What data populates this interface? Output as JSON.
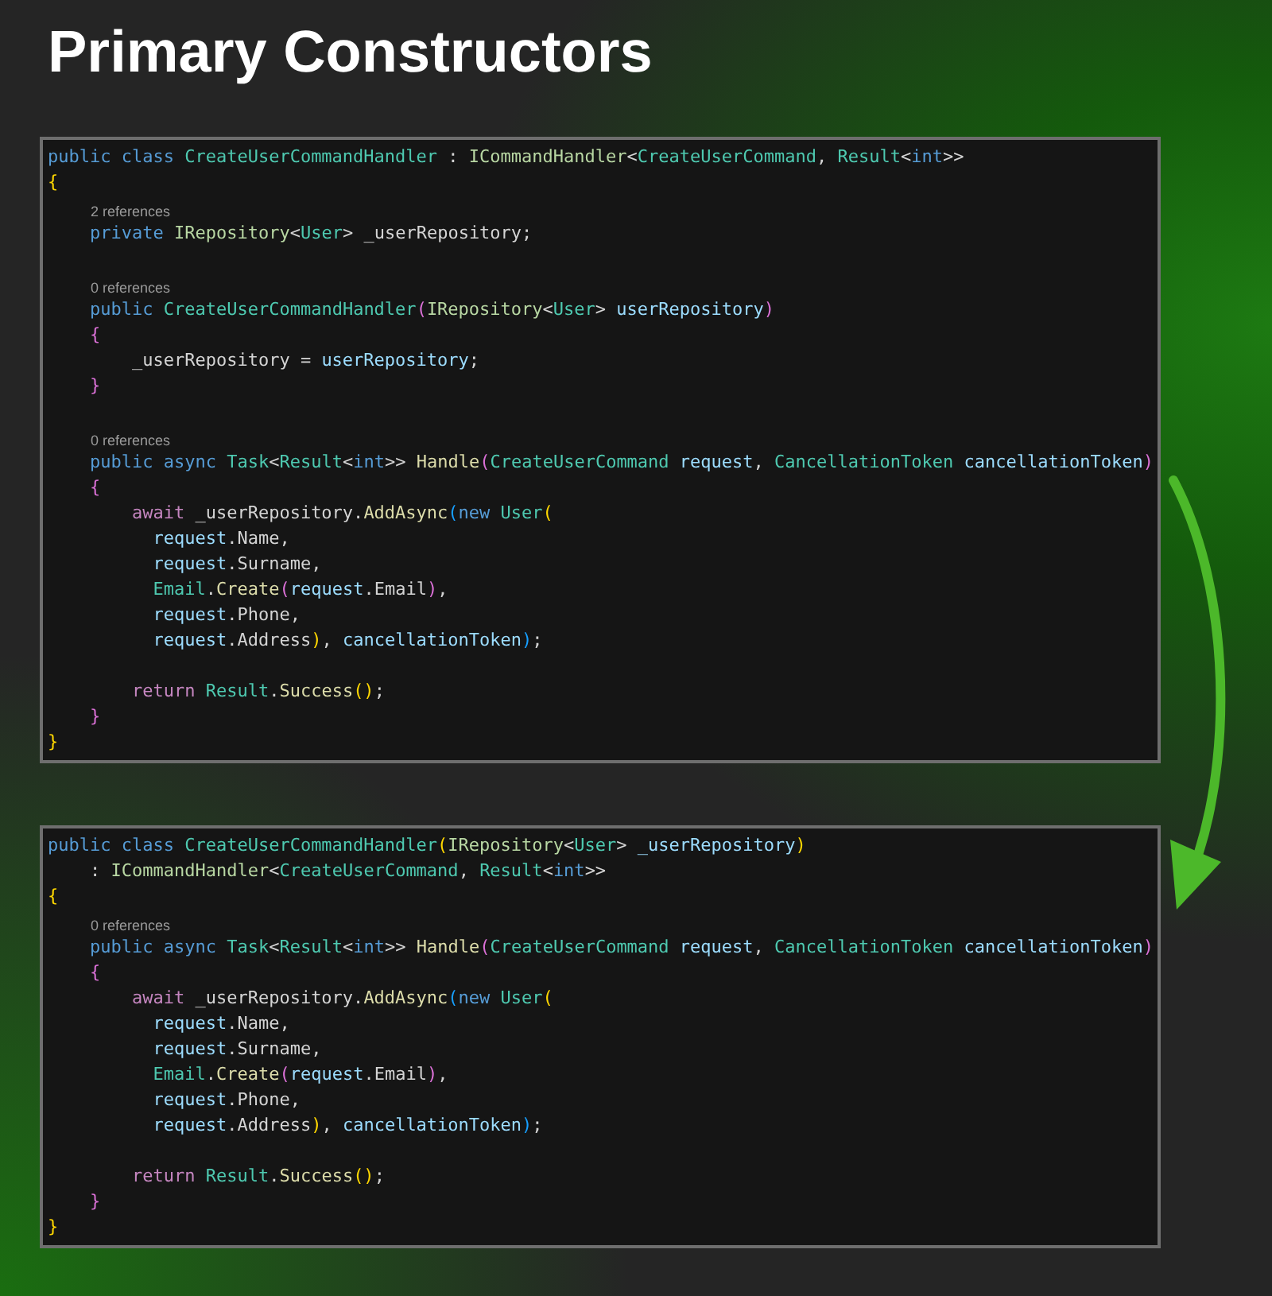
{
  "title": "Primary Constructors",
  "panels": [
    {
      "lines": [
        {
          "kind": "code",
          "tokens": [
            {
              "text": "public class ",
              "kind": "kw"
            },
            {
              "text": "CreateUserCommandHandler",
              "kind": "type"
            },
            {
              "text": " : ",
              "kind": "txt"
            },
            {
              "text": "ICommandHandler",
              "kind": "iface"
            },
            {
              "text": "<",
              "kind": "txt"
            },
            {
              "text": "CreateUserCommand",
              "kind": "type"
            },
            {
              "text": ", ",
              "kind": "txt"
            },
            {
              "text": "Result",
              "kind": "type"
            },
            {
              "text": "<",
              "kind": "txt"
            },
            {
              "text": "int",
              "kind": "kw"
            },
            {
              "text": ">>",
              "kind": "txt"
            }
          ]
        },
        {
          "kind": "code",
          "tokens": [
            {
              "text": "{",
              "kind": "b1"
            }
          ]
        },
        {
          "kind": "lens",
          "text": "2 references"
        },
        {
          "kind": "code",
          "tokens": [
            {
              "text": "    private ",
              "kind": "kw"
            },
            {
              "text": "IRepository",
              "kind": "iface"
            },
            {
              "text": "<",
              "kind": "txt"
            },
            {
              "text": "User",
              "kind": "type"
            },
            {
              "text": "> _userRepository;",
              "kind": "txt"
            }
          ]
        },
        {
          "kind": "blank"
        },
        {
          "kind": "lens",
          "text": "0 references"
        },
        {
          "kind": "code",
          "tokens": [
            {
              "text": "    public ",
              "kind": "kw"
            },
            {
              "text": "CreateUserCommandHandler",
              "kind": "type"
            },
            {
              "text": "(",
              "kind": "b2"
            },
            {
              "text": "IRepository",
              "kind": "iface"
            },
            {
              "text": "<",
              "kind": "txt"
            },
            {
              "text": "User",
              "kind": "type"
            },
            {
              "text": "> ",
              "kind": "txt"
            },
            {
              "text": "userRepository",
              "kind": "var"
            },
            {
              "text": ")",
              "kind": "b2"
            }
          ]
        },
        {
          "kind": "code",
          "tokens": [
            {
              "text": "    {",
              "kind": "b2"
            }
          ]
        },
        {
          "kind": "code",
          "tokens": [
            {
              "text": "        _userRepository = ",
              "kind": "txt"
            },
            {
              "text": "userRepository",
              "kind": "var"
            },
            {
              "text": ";",
              "kind": "txt"
            }
          ]
        },
        {
          "kind": "code",
          "tokens": [
            {
              "text": "    }",
              "kind": "b2"
            }
          ]
        },
        {
          "kind": "blank"
        },
        {
          "kind": "lens",
          "text": "0 references"
        },
        {
          "kind": "code",
          "tokens": [
            {
              "text": "    public async ",
              "kind": "kw"
            },
            {
              "text": "Task",
              "kind": "type"
            },
            {
              "text": "<",
              "kind": "txt"
            },
            {
              "text": "Result",
              "kind": "type"
            },
            {
              "text": "<",
              "kind": "txt"
            },
            {
              "text": "int",
              "kind": "kw"
            },
            {
              "text": ">> ",
              "kind": "txt"
            },
            {
              "text": "Handle",
              "kind": "fn"
            },
            {
              "text": "(",
              "kind": "b2"
            },
            {
              "text": "CreateUserCommand",
              "kind": "type"
            },
            {
              "text": " request",
              "kind": "var"
            },
            {
              "text": ", ",
              "kind": "txt"
            },
            {
              "text": "CancellationToken",
              "kind": "type"
            },
            {
              "text": " cancellationToken",
              "kind": "var"
            },
            {
              "text": ")",
              "kind": "b2"
            }
          ]
        },
        {
          "kind": "code",
          "tokens": [
            {
              "text": "    {",
              "kind": "b2"
            }
          ]
        },
        {
          "kind": "code",
          "tokens": [
            {
              "text": "        await",
              "kind": "ctl"
            },
            {
              "text": " _userRepository.",
              "kind": "txt"
            },
            {
              "text": "AddAsync",
              "kind": "fn"
            },
            {
              "text": "(",
              "kind": "b3"
            },
            {
              "text": "new ",
              "kind": "kw"
            },
            {
              "text": "User",
              "kind": "type"
            },
            {
              "text": "(",
              "kind": "b1"
            }
          ]
        },
        {
          "kind": "code",
          "tokens": [
            {
              "text": "          request",
              "kind": "var"
            },
            {
              "text": ".Name,",
              "kind": "txt"
            }
          ]
        },
        {
          "kind": "code",
          "tokens": [
            {
              "text": "          request",
              "kind": "var"
            },
            {
              "text": ".Surname,",
              "kind": "txt"
            }
          ]
        },
        {
          "kind": "code",
          "tokens": [
            {
              "text": "          Email",
              "kind": "type"
            },
            {
              "text": ".",
              "kind": "txt"
            },
            {
              "text": "Create",
              "kind": "fn"
            },
            {
              "text": "(",
              "kind": "b2"
            },
            {
              "text": "request",
              "kind": "var"
            },
            {
              "text": ".Email",
              "kind": "txt"
            },
            {
              "text": ")",
              "kind": "b2"
            },
            {
              "text": ",",
              "kind": "txt"
            }
          ]
        },
        {
          "kind": "code",
          "tokens": [
            {
              "text": "          request",
              "kind": "var"
            },
            {
              "text": ".Phone,",
              "kind": "txt"
            }
          ]
        },
        {
          "kind": "code",
          "tokens": [
            {
              "text": "          request",
              "kind": "var"
            },
            {
              "text": ".Address",
              "kind": "txt"
            },
            {
              "text": ")",
              "kind": "b1"
            },
            {
              "text": ", ",
              "kind": "txt"
            },
            {
              "text": "cancellationToken",
              "kind": "var"
            },
            {
              "text": ")",
              "kind": "b3"
            },
            {
              "text": ";",
              "kind": "txt"
            }
          ]
        },
        {
          "kind": "blank"
        },
        {
          "kind": "code",
          "tokens": [
            {
              "text": "        return",
              "kind": "ctl"
            },
            {
              "text": " Result",
              "kind": "type"
            },
            {
              "text": ".",
              "kind": "txt"
            },
            {
              "text": "Success",
              "kind": "fn"
            },
            {
              "text": "()",
              "kind": "b1"
            },
            {
              "text": ";",
              "kind": "txt"
            }
          ]
        },
        {
          "kind": "code",
          "tokens": [
            {
              "text": "    }",
              "kind": "b2"
            }
          ]
        },
        {
          "kind": "code",
          "tokens": [
            {
              "text": "}",
              "kind": "b1"
            }
          ]
        }
      ]
    },
    {
      "lines": [
        {
          "kind": "code",
          "tokens": [
            {
              "text": "public class ",
              "kind": "kw"
            },
            {
              "text": "CreateUserCommandHandler",
              "kind": "type"
            },
            {
              "text": "(",
              "kind": "b1"
            },
            {
              "text": "IRepository",
              "kind": "iface"
            },
            {
              "text": "<",
              "kind": "txt"
            },
            {
              "text": "User",
              "kind": "type"
            },
            {
              "text": "> ",
              "kind": "txt"
            },
            {
              "text": "_userRepository",
              "kind": "var"
            },
            {
              "text": ")",
              "kind": "b1"
            }
          ]
        },
        {
          "kind": "code",
          "tokens": [
            {
              "text": "    : ",
              "kind": "txt"
            },
            {
              "text": "ICommandHandler",
              "kind": "iface"
            },
            {
              "text": "<",
              "kind": "txt"
            },
            {
              "text": "CreateUserCommand",
              "kind": "type"
            },
            {
              "text": ", ",
              "kind": "txt"
            },
            {
              "text": "Result",
              "kind": "type"
            },
            {
              "text": "<",
              "kind": "txt"
            },
            {
              "text": "int",
              "kind": "kw"
            },
            {
              "text": ">>",
              "kind": "txt"
            }
          ]
        },
        {
          "kind": "code",
          "tokens": [
            {
              "text": "{",
              "kind": "b1"
            }
          ]
        },
        {
          "kind": "lens",
          "text": "0 references"
        },
        {
          "kind": "code",
          "tokens": [
            {
              "text": "    public async ",
              "kind": "kw"
            },
            {
              "text": "Task",
              "kind": "type"
            },
            {
              "text": "<",
              "kind": "txt"
            },
            {
              "text": "Result",
              "kind": "type"
            },
            {
              "text": "<",
              "kind": "txt"
            },
            {
              "text": "int",
              "kind": "kw"
            },
            {
              "text": ">> ",
              "kind": "txt"
            },
            {
              "text": "Handle",
              "kind": "fn"
            },
            {
              "text": "(",
              "kind": "b2"
            },
            {
              "text": "CreateUserCommand",
              "kind": "type"
            },
            {
              "text": " request",
              "kind": "var"
            },
            {
              "text": ", ",
              "kind": "txt"
            },
            {
              "text": "CancellationToken",
              "kind": "type"
            },
            {
              "text": " cancellationToken",
              "kind": "var"
            },
            {
              "text": ")",
              "kind": "b2"
            }
          ]
        },
        {
          "kind": "code",
          "tokens": [
            {
              "text": "    {",
              "kind": "b2"
            }
          ]
        },
        {
          "kind": "code",
          "tokens": [
            {
              "text": "        await",
              "kind": "ctl"
            },
            {
              "text": " _userRepository.",
              "kind": "txt"
            },
            {
              "text": "AddAsync",
              "kind": "fn"
            },
            {
              "text": "(",
              "kind": "b3"
            },
            {
              "text": "new ",
              "kind": "kw"
            },
            {
              "text": "User",
              "kind": "type"
            },
            {
              "text": "(",
              "kind": "b1"
            }
          ]
        },
        {
          "kind": "code",
          "tokens": [
            {
              "text": "          request",
              "kind": "var"
            },
            {
              "text": ".Name,",
              "kind": "txt"
            }
          ]
        },
        {
          "kind": "code",
          "tokens": [
            {
              "text": "          request",
              "kind": "var"
            },
            {
              "text": ".Surname,",
              "kind": "txt"
            }
          ]
        },
        {
          "kind": "code",
          "tokens": [
            {
              "text": "          Email",
              "kind": "type"
            },
            {
              "text": ".",
              "kind": "txt"
            },
            {
              "text": "Create",
              "kind": "fn"
            },
            {
              "text": "(",
              "kind": "b2"
            },
            {
              "text": "request",
              "kind": "var"
            },
            {
              "text": ".Email",
              "kind": "txt"
            },
            {
              "text": ")",
              "kind": "b2"
            },
            {
              "text": ",",
              "kind": "txt"
            }
          ]
        },
        {
          "kind": "code",
          "tokens": [
            {
              "text": "          request",
              "kind": "var"
            },
            {
              "text": ".Phone,",
              "kind": "txt"
            }
          ]
        },
        {
          "kind": "code",
          "tokens": [
            {
              "text": "          request",
              "kind": "var"
            },
            {
              "text": ".Address",
              "kind": "txt"
            },
            {
              "text": ")",
              "kind": "b1"
            },
            {
              "text": ", ",
              "kind": "txt"
            },
            {
              "text": "cancellationToken",
              "kind": "var"
            },
            {
              "text": ")",
              "kind": "b3"
            },
            {
              "text": ";",
              "kind": "txt"
            }
          ]
        },
        {
          "kind": "blank"
        },
        {
          "kind": "code",
          "tokens": [
            {
              "text": "        return",
              "kind": "ctl"
            },
            {
              "text": " Result",
              "kind": "type"
            },
            {
              "text": ".",
              "kind": "txt"
            },
            {
              "text": "Success",
              "kind": "fn"
            },
            {
              "text": "()",
              "kind": "b1"
            },
            {
              "text": ";",
              "kind": "txt"
            }
          ]
        },
        {
          "kind": "code",
          "tokens": [
            {
              "text": "    }",
              "kind": "b2"
            }
          ]
        },
        {
          "kind": "code",
          "tokens": [
            {
              "text": "}",
              "kind": "b1"
            }
          ]
        }
      ]
    }
  ]
}
